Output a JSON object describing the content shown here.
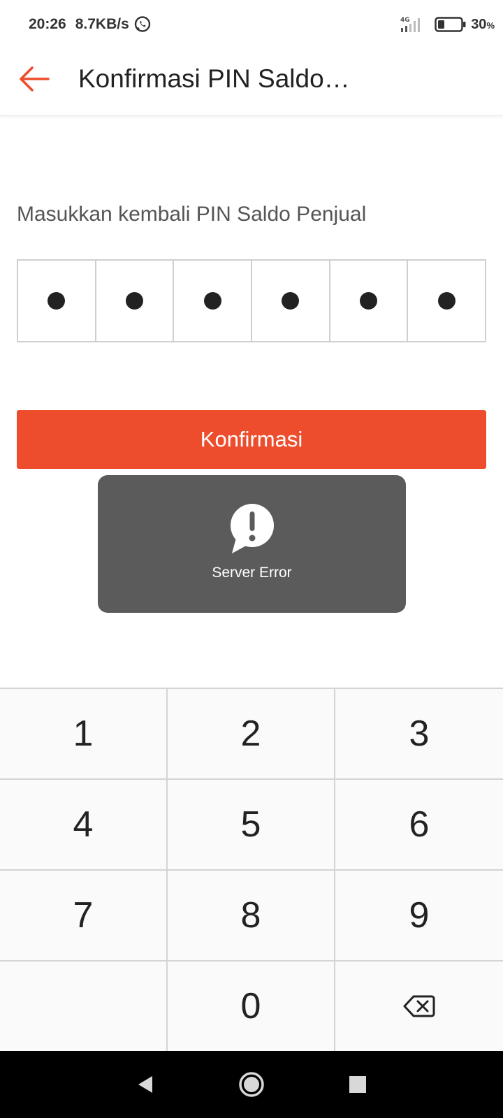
{
  "status_bar": {
    "time": "20:26",
    "network_speed": "8.7KB/s",
    "network_type": "4G",
    "battery_percent": "30",
    "battery_unit": "%",
    "battery_level": 0.3
  },
  "app_bar": {
    "title": "Konfirmasi PIN Saldo…",
    "back_icon": "arrow-left-icon"
  },
  "pin_entry": {
    "prompt": "Masukkan kembali PIN Saldo Penjual",
    "digits_entered": 6,
    "digits_total": 6
  },
  "confirm_button": {
    "label": "Konfirmasi"
  },
  "toast": {
    "icon": "alert-bubble-icon",
    "message": "Server Error"
  },
  "keypad": {
    "keys": [
      "1",
      "2",
      "3",
      "4",
      "5",
      "6",
      "7",
      "8",
      "9",
      "",
      "0",
      "backspace"
    ]
  },
  "colors": {
    "accent": "#ee4d2d",
    "toast_bg": "#5b5b5b",
    "text_primary": "#222222",
    "text_secondary": "#555555"
  }
}
